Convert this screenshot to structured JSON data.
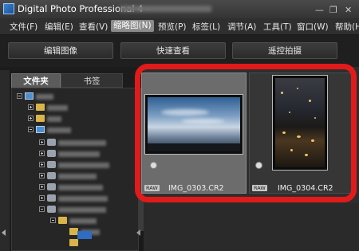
{
  "window": {
    "title": "Digital Photo Professional 4 -",
    "controls": [
      "—",
      "❐",
      "✕"
    ]
  },
  "menubar": {
    "items": [
      {
        "label": "文件(F)"
      },
      {
        "label": "编辑(E)"
      },
      {
        "label": "查看(V)"
      },
      {
        "label": "缩略图(N)",
        "active": true
      },
      {
        "label": "预览(P)"
      },
      {
        "label": "标签(L)"
      },
      {
        "label": "调节(A)"
      },
      {
        "label": "工具(T)"
      },
      {
        "label": "窗口(W)"
      },
      {
        "label": "帮助(H)"
      }
    ]
  },
  "toolbar": {
    "buttons": [
      {
        "label": "编辑图像"
      },
      {
        "label": "快速查看"
      },
      {
        "label": "遥控拍摄"
      }
    ]
  },
  "sidebar": {
    "tabs": [
      {
        "label": "文件夹",
        "active": true
      },
      {
        "label": "书签"
      }
    ]
  },
  "thumbnails": [
    {
      "filename": "IMG_0303.CR2",
      "badge": "RAW",
      "selected": true
    },
    {
      "filename": "IMG_0304.CR2",
      "badge": "RAW",
      "selected": false
    }
  ],
  "colors": {
    "highlight_frame": "#e11a1a",
    "selected_tile": "#6c6c6c",
    "accent_blue": "#2f6cc2"
  }
}
